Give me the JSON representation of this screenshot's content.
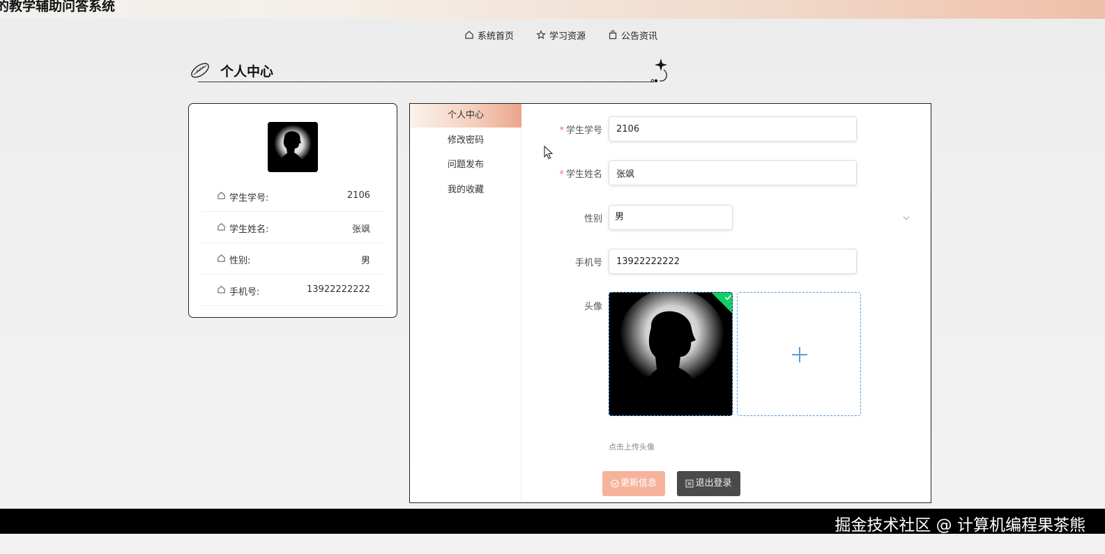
{
  "site": {
    "title": "的教学辅助问答系统"
  },
  "nav": [
    {
      "label": "系统首页",
      "icon": "home-icon"
    },
    {
      "label": "学习资源",
      "icon": "star-icon"
    },
    {
      "label": "公告资讯",
      "icon": "bag-icon"
    }
  ],
  "section": {
    "title": "个人中心"
  },
  "profile": {
    "rows": [
      {
        "label": "学生学号:",
        "value": "2106"
      },
      {
        "label": "学生姓名:",
        "value": "张飒"
      },
      {
        "label": "性别:",
        "value": "男"
      },
      {
        "label": "手机号:",
        "value": "13922222222"
      }
    ]
  },
  "menu": [
    {
      "label": "个人中心",
      "active": true
    },
    {
      "label": "修改密码"
    },
    {
      "label": "问题发布"
    },
    {
      "label": "我的收藏"
    }
  ],
  "form": {
    "student_id": {
      "label": "学生学号",
      "value": "2106",
      "required": true
    },
    "student_name": {
      "label": "学生姓名",
      "value": "张飒",
      "required": true
    },
    "gender": {
      "label": "性别",
      "value": "男"
    },
    "phone": {
      "label": "手机号",
      "value": "13922222222"
    },
    "avatar": {
      "label": "头像",
      "tip": "点击上传头像"
    },
    "update_label": "更新信息",
    "logout_label": "退出登录"
  },
  "footer": {
    "watermark": "掘金技术社区 @ 计算机编程果茶熊"
  },
  "colors": {
    "accent": "#eaa58b",
    "button_update": "#f5b39b",
    "button_logout": "#4a4a4a",
    "success": "#13ce66"
  }
}
